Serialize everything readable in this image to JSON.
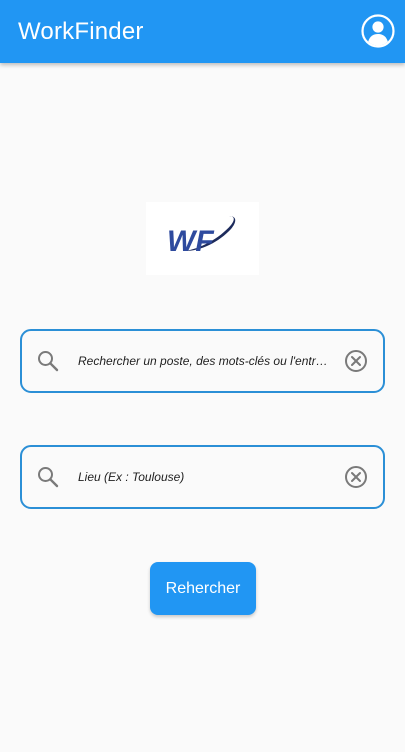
{
  "app": {
    "title": "WorkFinder",
    "primary_color": "#2196f3",
    "profile_icon": "account-circle-icon"
  },
  "logo": {
    "text": "WF",
    "icon": "workfinder-logo"
  },
  "search": {
    "keyword_placeholder": "Rechercher un poste, des mots-clés ou l'entreprise",
    "keyword_value": "",
    "location_placeholder": "Lieu (Ex : Toulouse)",
    "location_value": "",
    "search_icon": "search-icon",
    "clear_icon": "clear-circle-icon",
    "submit_label": "Rehercher"
  }
}
